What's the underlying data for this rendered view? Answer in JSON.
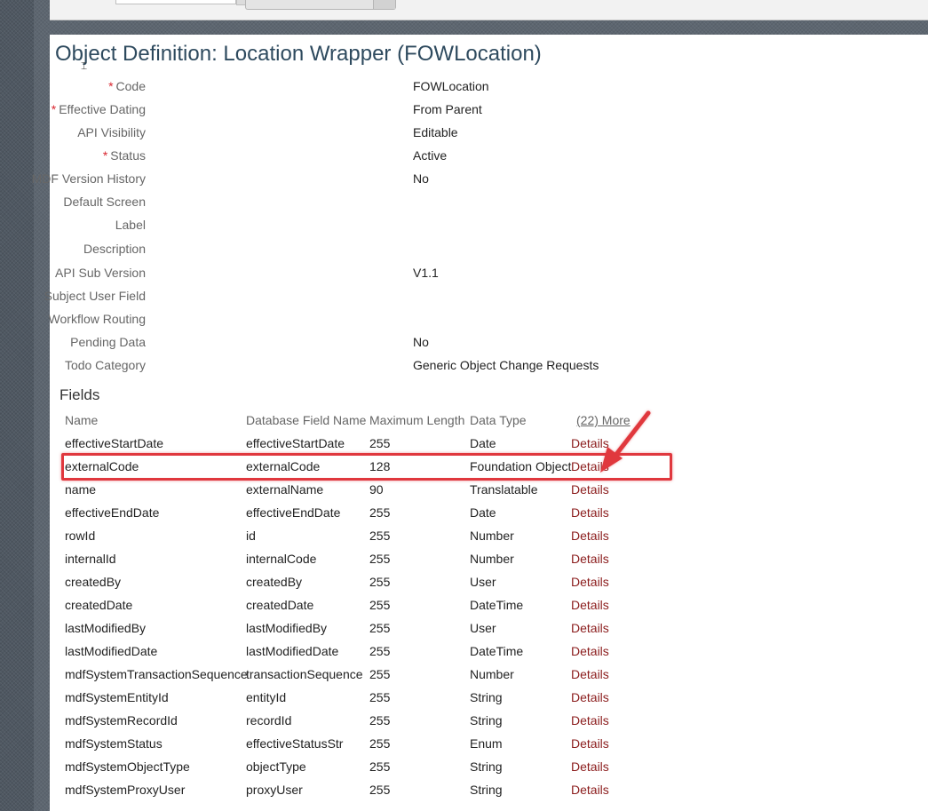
{
  "page": {
    "title": "Object Definition: Location Wrapper (FOWLocation)"
  },
  "properties": [
    {
      "label": "Code",
      "required": true,
      "value": "FOWLocation"
    },
    {
      "label": "Effective Dating",
      "required": true,
      "value": "From Parent"
    },
    {
      "label": "API Visibility",
      "required": false,
      "value": "Editable"
    },
    {
      "label": "Status",
      "required": true,
      "value": "Active"
    },
    {
      "label": "MDF Version History",
      "required": false,
      "value": "No"
    },
    {
      "label": "Default Screen",
      "required": false,
      "value": ""
    },
    {
      "label": "Label",
      "required": false,
      "value": ""
    },
    {
      "label": "Description",
      "required": false,
      "value": ""
    },
    {
      "label": "API Sub Version",
      "required": false,
      "value": "V1.1"
    },
    {
      "label": "Subject User Field",
      "required": false,
      "value": ""
    },
    {
      "label": "Workflow Routing",
      "required": false,
      "value": ""
    },
    {
      "label": "Pending Data",
      "required": false,
      "value": "No"
    },
    {
      "label": "Todo Category",
      "required": false,
      "value": "Generic Object Change Requests"
    }
  ],
  "required_marker": "*",
  "fields": {
    "heading": "Fields",
    "columns": [
      "Name",
      "Database Field Name",
      "Maximum Length",
      "Data Type"
    ],
    "more_link": "(22) More",
    "rows": [
      [
        "effectiveStartDate",
        "effectiveStartDate",
        "255",
        "Date",
        "Details"
      ],
      [
        "externalCode",
        "externalCode",
        "128",
        "Foundation Object",
        "Details"
      ],
      [
        "name",
        "externalName",
        "90",
        "Translatable",
        "Details"
      ],
      [
        "effectiveEndDate",
        "effectiveEndDate",
        "255",
        "Date",
        "Details"
      ],
      [
        "rowId",
        "id",
        "255",
        "Number",
        "Details"
      ],
      [
        "internalId",
        "internalCode",
        "255",
        "Number",
        "Details"
      ],
      [
        "createdBy",
        "createdBy",
        "255",
        "User",
        "Details"
      ],
      [
        "createdDate",
        "createdDate",
        "255",
        "DateTime",
        "Details"
      ],
      [
        "lastModifiedBy",
        "lastModifiedBy",
        "255",
        "User",
        "Details"
      ],
      [
        "lastModifiedDate",
        "lastModifiedDate",
        "255",
        "DateTime",
        "Details"
      ],
      [
        "mdfSystemTransactionSequence",
        "transactionSequence",
        "255",
        "Number",
        "Details"
      ],
      [
        "mdfSystemEntityId",
        "entityId",
        "255",
        "String",
        "Details"
      ],
      [
        "mdfSystemRecordId",
        "recordId",
        "255",
        "String",
        "Details"
      ],
      [
        "mdfSystemStatus",
        "effectiveStatusStr",
        "255",
        "Enum",
        "Details"
      ],
      [
        "mdfSystemObjectType",
        "objectType",
        "255",
        "String",
        "Details"
      ],
      [
        "mdfSystemProxyUser",
        "proxyUser",
        "255",
        "String",
        "Details"
      ]
    ]
  },
  "annotation": {
    "highlighted_row": "externalCode",
    "color": "#e0383e"
  },
  "colors": {
    "title": "#2e4a5e",
    "link": "#8b1c1c",
    "required": "#d9262f"
  }
}
